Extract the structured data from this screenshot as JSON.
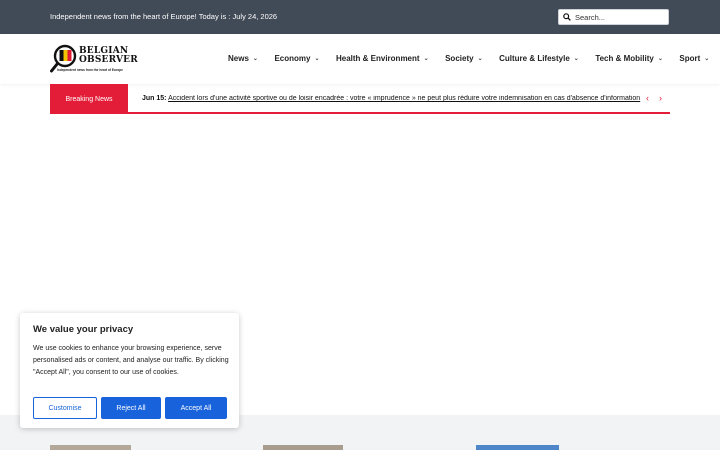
{
  "topbar": {
    "tagline": "Independent news from the heart of Europe! Today is : July 24, 2026",
    "search_placeholder": "Search...",
    "search_icon": "search-icon"
  },
  "logo": {
    "line1": "BELGIAN",
    "line2": "OBSERVER",
    "tagline": "Independent news from the heart of Europe"
  },
  "nav": {
    "items": [
      {
        "label": "News"
      },
      {
        "label": "Economy"
      },
      {
        "label": "Health & Environment"
      },
      {
        "label": "Society"
      },
      {
        "label": "Culture & Lifestyle"
      },
      {
        "label": "Tech & Mobility"
      },
      {
        "label": "Sport"
      }
    ],
    "chevron": "⌄"
  },
  "breaking": {
    "label": "Breaking News",
    "date": "Jun 15:",
    "headline": "Accident lors d'une activité sportive ou de loisir encadrée : votre « imprudence » ne peut plus réduire votre indemnisation en cas d'absence d'information",
    "prev_icon": "chevron-left-icon",
    "next_icon": "chevron-right-icon",
    "accent": "#e31d38"
  },
  "cookie": {
    "title": "We value your privacy",
    "text": "We use cookies to enhance your browsing experience, serve personalised ads or content, and analyse our traffic. By clicking \"Accept All\", you consent to our use of cookies.",
    "customise": "Customise",
    "reject": "Reject All",
    "accept": "Accept All",
    "accent": "#1863dc"
  },
  "colors": {
    "topbar": "#414a57",
    "brand_red": "#e31d38",
    "footer_strip": "#f1f3f5"
  }
}
